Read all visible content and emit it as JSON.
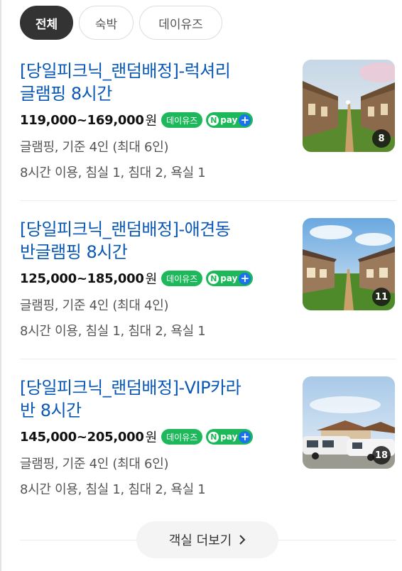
{
  "tabs": [
    {
      "label": "전체",
      "active": true
    },
    {
      "label": "숙박",
      "active": false
    },
    {
      "label": "데이유즈",
      "active": false
    }
  ],
  "listings": [
    {
      "title_line1": "[당일피크닉_랜덤배정]-럭셔리",
      "title_line2": "글램핑 8시간",
      "price": "119,000~169,000",
      "currency": "원",
      "badge_dayuse": "데이유즈",
      "badge_npay": "pay",
      "info": "글램핑, 기준 4인 (최대 6인)",
      "amenities": "8시간 이용, 침실 1, 침대 2, 욕실 1",
      "photo_count": "8"
    },
    {
      "title_line1": "[당일피크닉_랜덤배정]-애견동",
      "title_line2": "반글램핑 8시간",
      "price": "125,000~185,000",
      "currency": "원",
      "badge_dayuse": "데이유즈",
      "badge_npay": "pay",
      "info": "글램핑, 기준 4인 (최대 4인)",
      "amenities": "8시간 이용, 침실 1, 침대 2, 욕실 1",
      "photo_count": "11"
    },
    {
      "title_line1": "[당일피크닉_랜덤배정]-VIP카라",
      "title_line2": "반 8시간",
      "price": "145,000~205,000",
      "currency": "원",
      "badge_dayuse": "데이유즈",
      "badge_npay": "pay",
      "info": "글램핑, 기준 4인 (최대 6인)",
      "amenities": "8시간 이용, 침실 1, 침대 2, 욕실 1",
      "photo_count": "18"
    }
  ],
  "more_button": {
    "label": "객실 더보기",
    "icon": "chevron-right-icon"
  },
  "icons": {
    "npay_n": "N",
    "plus": "+"
  },
  "colors": {
    "link": "#0a58b5",
    "badge_green": "#1db85a",
    "plus_blue": "#1a73e8",
    "active_tab": "#333333"
  }
}
